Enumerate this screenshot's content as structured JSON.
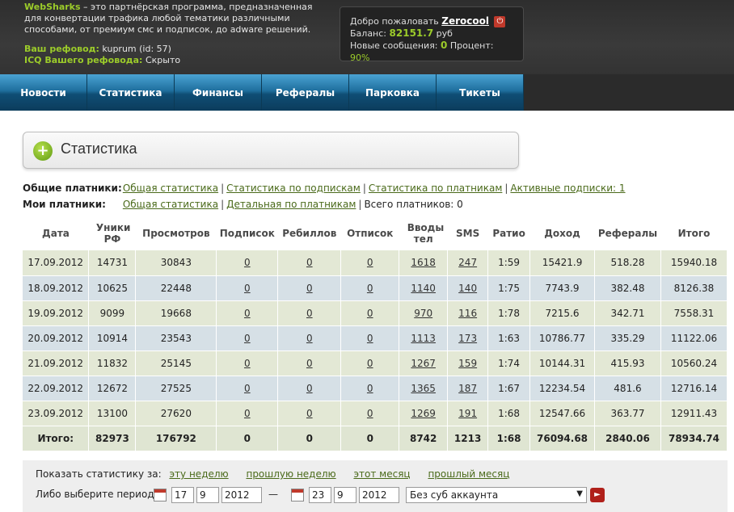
{
  "header": {
    "brand": "WebSharks",
    "description": " – это партнёрская программа, предназначенная для конвертации трафика любой тематики различными способами, от премиум смс и подписок, до adware решений.",
    "referrer_label": "Ваш рефовод:",
    "referrer_value": " kuprum (id: 57)",
    "icq_label": "ICQ Вашего рефовода:",
    "icq_value": " Скрыто"
  },
  "user": {
    "welcome": "Добро пожаловать",
    "username": "Zerocool",
    "balance_label": "Баланс:",
    "balance_value": "82151.7",
    "balance_currency": " руб",
    "messages_label": "Новые сообщения:",
    "messages_value": "0",
    "percent_label": " Процент:",
    "percent_value": " 90%"
  },
  "nav": [
    "Новости",
    "Статистика",
    "Финансы",
    "Рефералы",
    "Парковка",
    "Тикеты"
  ],
  "page_title": "Статистика",
  "general_payers": {
    "label": "Общие платники:",
    "links": [
      "Общая статистика",
      "Статистика по подпискам",
      "Статистика по платникам",
      "Активные подписки: 1"
    ]
  },
  "my_payers": {
    "label": "Мои платники:",
    "links": [
      "Общая статистика",
      "Детальная по платникам"
    ],
    "total": "Всего платников: 0"
  },
  "table": {
    "headers": [
      "Дата",
      "Уники РФ",
      "Просмотров",
      "Подписок",
      "Ребиллов",
      "Отписок",
      "Вводы тел",
      "SMS",
      "Ратио",
      "Доход",
      "Рефералы",
      "Итого"
    ],
    "rows": [
      [
        "17.09.2012",
        "14731",
        "30843",
        "0",
        "0",
        "0",
        "1618",
        "247",
        "1:59",
        "15421.9",
        "518.28",
        "15940.18"
      ],
      [
        "18.09.2012",
        "10625",
        "22448",
        "0",
        "0",
        "0",
        "1140",
        "140",
        "1:75",
        "7743.9",
        "382.48",
        "8126.38"
      ],
      [
        "19.09.2012",
        "9099",
        "19668",
        "0",
        "0",
        "0",
        "970",
        "116",
        "1:78",
        "7215.6",
        "342.71",
        "7558.31"
      ],
      [
        "20.09.2012",
        "10914",
        "23543",
        "0",
        "0",
        "0",
        "1113",
        "173",
        "1:63",
        "10786.77",
        "335.29",
        "11122.06"
      ],
      [
        "21.09.2012",
        "11832",
        "25145",
        "0",
        "0",
        "0",
        "1267",
        "159",
        "1:74",
        "10144.31",
        "415.93",
        "10560.24"
      ],
      [
        "22.09.2012",
        "12672",
        "27525",
        "0",
        "0",
        "0",
        "1365",
        "187",
        "1:67",
        "12234.54",
        "481.6",
        "12716.14"
      ],
      [
        "23.09.2012",
        "13100",
        "27620",
        "0",
        "0",
        "0",
        "1269",
        "191",
        "1:68",
        "12547.66",
        "363.77",
        "12911.43"
      ]
    ],
    "total": [
      "Итого:",
      "82973",
      "176792",
      "0",
      "0",
      "0",
      "8742",
      "1213",
      "1:68",
      "76094.68",
      "2840.06",
      "78934.74"
    ]
  },
  "filter": {
    "show_label": "Показать статистику за:",
    "periods": [
      "эту неделю",
      "прошлую неделю",
      "этот месяц",
      "прошлый месяц"
    ],
    "range_label": "Либо выберите период:",
    "from_day": "17",
    "from_month": "9",
    "from_year": "2012",
    "dash": "—",
    "to_day": "23",
    "to_month": "9",
    "to_year": "2012",
    "subaccount": "Без суб аккаунта"
  }
}
